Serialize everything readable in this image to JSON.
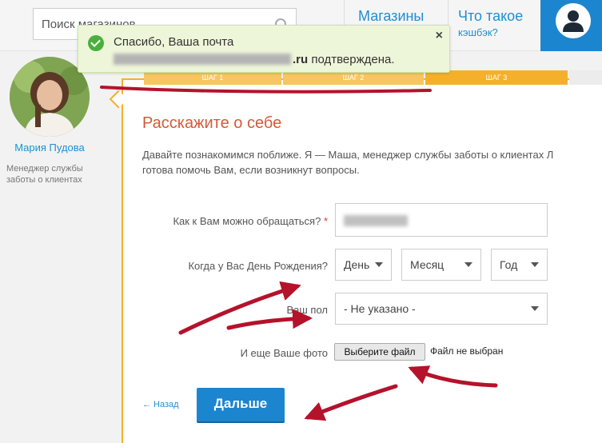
{
  "header": {
    "search": {
      "placeholder": "Поиск магазинов",
      "icon": "search-icon"
    },
    "nav_shops": "Магазины",
    "nav_cashback_line1": "Что такое",
    "nav_cashback_line2": "кэшбэк?",
    "profile_icon": "user-icon"
  },
  "manager": {
    "name": "Мария Пудова",
    "role": "Менеджер службы заботы о клиентах"
  },
  "toast": {
    "line1": "Спасибо, Ваша почта",
    "email_tail": ".ru",
    "line2_suffix": " подтверждена.",
    "close": "×"
  },
  "steps": [
    "шаг 1",
    "шаг 2",
    "шаг 3",
    ""
  ],
  "form": {
    "title": "Расскажите о себе",
    "intro_line1": "Давайте познакомимся поближе. Я — Маша, менеджер службы заботы о клиентах Л",
    "intro_line2": "готова помочь Вам, если возникнут вопросы.",
    "name_label": "Как к Вам можно обращаться?",
    "required_mark": "*",
    "birthday_label": "Когда у Вас День Рождения?",
    "day": "День",
    "month": "Месяц",
    "year": "Год",
    "gender_label": "Ваш пол",
    "gender_value": "- Не указано -",
    "photo_label": "И еще Ваше фото",
    "file_button": "Выберите файл",
    "file_status": "Файл не выбран",
    "back": "← Назад",
    "next": "Дальше"
  },
  "colors": {
    "accent": "#1c85cf",
    "title": "#d35a3a",
    "panel_border": "#f5b02b",
    "annotation": "#b5122b"
  }
}
